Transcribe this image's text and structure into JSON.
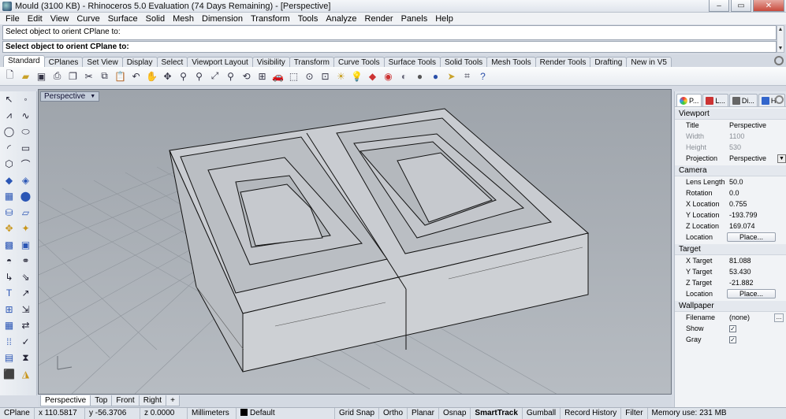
{
  "window": {
    "title": "Mould (3100 KB) - Rhinoceros 5.0 Evaluation (74 Days Remaining) - [Perspective]",
    "minimize": "–",
    "maximize": "▭",
    "close": "✕"
  },
  "menu": [
    "File",
    "Edit",
    "View",
    "Curve",
    "Surface",
    "Solid",
    "Mesh",
    "Dimension",
    "Transform",
    "Tools",
    "Analyze",
    "Render",
    "Panels",
    "Help"
  ],
  "command": {
    "history": "Select object to orient CPlane to:",
    "prompt": "Select object to orient CPlane to:"
  },
  "toolbar_tabs": [
    "Standard",
    "CPlanes",
    "Set View",
    "Display",
    "Select",
    "Viewport Layout",
    "Visibility",
    "Transform",
    "Curve Tools",
    "Surface Tools",
    "Solid Tools",
    "Mesh Tools",
    "Render Tools",
    "Drafting",
    "New in V5"
  ],
  "toolbar_icons": [
    "new-icon",
    "open-icon",
    "save-icon",
    "print-icon",
    "import-icon",
    "cut-icon",
    "copy-icon",
    "paste-icon",
    "undo-icon",
    "pan-icon",
    "rotate-view-icon",
    "zoom-icon",
    "zoom-window-icon",
    "zoom-extents-icon",
    "zoom-selected-icon",
    "undo-view-icon",
    "four-views-icon",
    "car-icon",
    "select-icon",
    "grid-icon",
    "named-cplane-icon",
    "light-icon",
    "layer-icon",
    "color-icon",
    "render-wire-icon",
    "shaded-icon",
    "rendered-icon",
    "material-icon",
    "pivot-icon",
    "cplane-icon",
    "help-icon"
  ],
  "viewport": {
    "title": "Perspective"
  },
  "viewport_tabs": [
    "Perspective",
    "Top",
    "Front",
    "Right",
    "+"
  ],
  "panel": {
    "tabs": [
      "P...",
      "L...",
      "Di...",
      "H..."
    ],
    "viewport_section": "Viewport",
    "title_label": "Title",
    "title_value": "Perspective",
    "width_label": "Width",
    "width_value": "1100",
    "height_label": "Height",
    "height_value": "530",
    "projection_label": "Projection",
    "projection_value": "Perspective",
    "camera_section": "Camera",
    "lens_label": "Lens Length",
    "lens_value": "50.0",
    "rotation_label": "Rotation",
    "rotation_value": "0.0",
    "xloc_label": "X Location",
    "xloc_value": "0.755",
    "yloc_label": "Y Location",
    "yloc_value": "-193.799",
    "zloc_label": "Z Location",
    "zloc_value": "169.074",
    "location_label": "Location",
    "place_button": "Place...",
    "target_section": "Target",
    "xt_label": "X Target",
    "xt_value": "81.088",
    "yt_label": "Y Target",
    "yt_value": "53.430",
    "zt_label": "Z Target",
    "zt_value": "-21.882",
    "tlocation_label": "Location",
    "tplace_button": "Place...",
    "wallpaper_section": "Wallpaper",
    "filename_label": "Filename",
    "filename_value": "(none)",
    "browse": "...",
    "show_label": "Show",
    "gray_label": "Gray",
    "check": "✓"
  },
  "status": {
    "cplane": "CPlane",
    "x": "x 110.5817",
    "y": "y -56.3706",
    "z": "z 0.0000",
    "units": "Millimeters",
    "layer": "Default",
    "gridsnap": "Grid Snap",
    "ortho": "Ortho",
    "planar": "Planar",
    "osnap": "Osnap",
    "smarttrack": "SmartTrack",
    "gumball": "Gumball",
    "record": "Record History",
    "filter": "Filter",
    "memory": "Memory use: 231 MB"
  }
}
